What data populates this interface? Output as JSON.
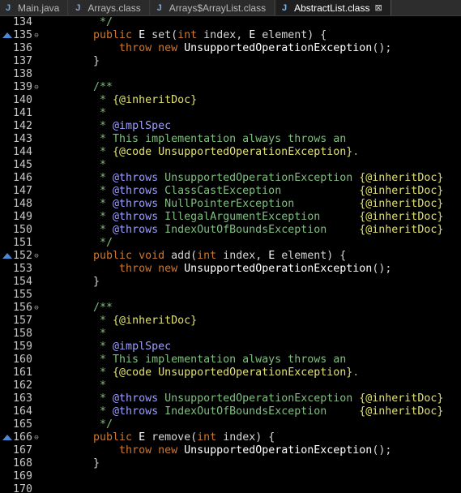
{
  "tabs": [
    {
      "label": "Main.java",
      "icon": "java-file-icon",
      "active": false
    },
    {
      "label": "Arrays.class",
      "icon": "class-file-icon",
      "active": false
    },
    {
      "label": "Arrays$ArrayList.class",
      "icon": "class-file-icon",
      "active": false
    },
    {
      "label": "AbstractList.class",
      "icon": "class-file-icon",
      "active": true,
      "close": "⊠"
    }
  ],
  "lines": [
    {
      "num": "134",
      "text": "     */"
    },
    {
      "num": "135",
      "text": "    public E set(int index, E element) {",
      "marker": true,
      "fold": "⊖"
    },
    {
      "num": "136",
      "text": "        throw new UnsupportedOperationException();"
    },
    {
      "num": "137",
      "text": "    }"
    },
    {
      "num": "138",
      "text": ""
    },
    {
      "num": "139",
      "text": "    /**",
      "fold": "⊖"
    },
    {
      "num": "140",
      "text": "     * {@inheritDoc}"
    },
    {
      "num": "141",
      "text": "     *"
    },
    {
      "num": "142",
      "text": "     * @implSpec"
    },
    {
      "num": "143",
      "text": "     * This implementation always throws an"
    },
    {
      "num": "144",
      "text": "     * {@code UnsupportedOperationException}."
    },
    {
      "num": "145",
      "text": "     *"
    },
    {
      "num": "146",
      "text": "     * @throws UnsupportedOperationException {@inheritDoc}"
    },
    {
      "num": "147",
      "text": "     * @throws ClassCastException            {@inheritDoc}"
    },
    {
      "num": "148",
      "text": "     * @throws NullPointerException          {@inheritDoc}"
    },
    {
      "num": "149",
      "text": "     * @throws IllegalArgumentException      {@inheritDoc}"
    },
    {
      "num": "150",
      "text": "     * @throws IndexOutOfBoundsException     {@inheritDoc}"
    },
    {
      "num": "151",
      "text": "     */"
    },
    {
      "num": "152",
      "text": "    public void add(int index, E element) {",
      "marker": true,
      "fold": "⊖"
    },
    {
      "num": "153",
      "text": "        throw new UnsupportedOperationException();"
    },
    {
      "num": "154",
      "text": "    }"
    },
    {
      "num": "155",
      "text": ""
    },
    {
      "num": "156",
      "text": "    /**",
      "fold": "⊖"
    },
    {
      "num": "157",
      "text": "     * {@inheritDoc}"
    },
    {
      "num": "158",
      "text": "     *"
    },
    {
      "num": "159",
      "text": "     * @implSpec"
    },
    {
      "num": "160",
      "text": "     * This implementation always throws an"
    },
    {
      "num": "161",
      "text": "     * {@code UnsupportedOperationException}."
    },
    {
      "num": "162",
      "text": "     *"
    },
    {
      "num": "163",
      "text": "     * @throws UnsupportedOperationException {@inheritDoc}"
    },
    {
      "num": "164",
      "text": "     * @throws IndexOutOfBoundsException     {@inheritDoc}"
    },
    {
      "num": "165",
      "text": "     */"
    },
    {
      "num": "166",
      "text": "    public E remove(int index) {",
      "marker": true,
      "fold": "⊖"
    },
    {
      "num": "167",
      "text": "        throw new UnsupportedOperationException();"
    },
    {
      "num": "168",
      "text": "    }"
    },
    {
      "num": "169",
      "text": ""
    },
    {
      "num": "170",
      "text": ""
    }
  ],
  "colors": {
    "background": "#000000",
    "keyword": "#cc7832",
    "comment": "#7fbf7f",
    "javadoc_tag": "#9e9eff",
    "inline_tag": "#e0e070",
    "override_marker": "#4a88d6"
  }
}
